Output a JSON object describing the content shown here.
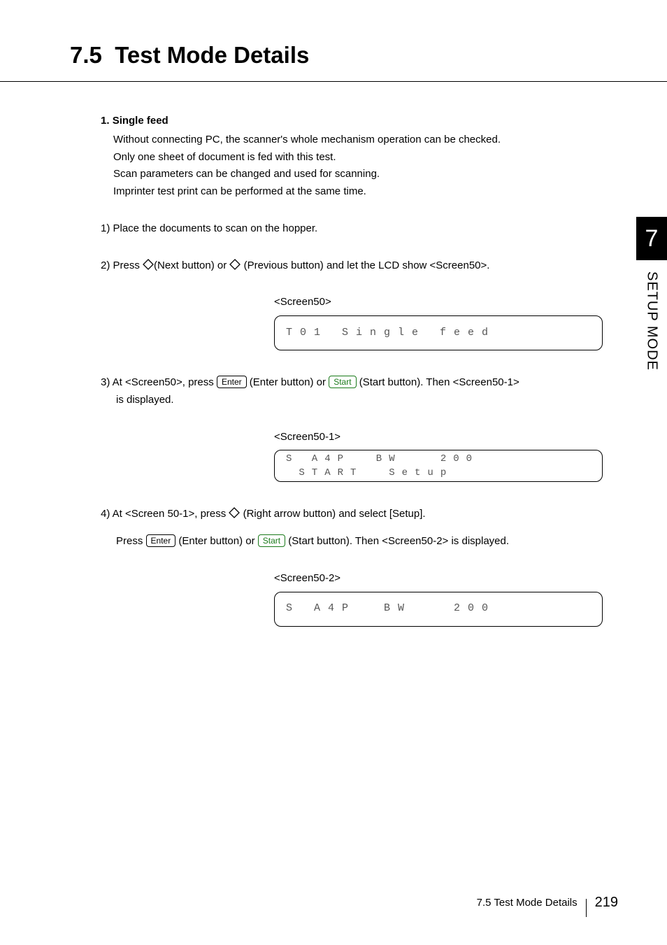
{
  "section": {
    "number": "7.5",
    "title": "Test Mode Details"
  },
  "item": {
    "number": "1.",
    "name": "Single feed",
    "desc_l1": "Without connecting PC, the scanner's whole mechanism operation can be checked.",
    "desc_l2": "Only one sheet of document is fed with this test.",
    "desc_l3": "Scan parameters can be changed and used for scanning.",
    "desc_l4": "Imprinter test print can be performed at the same time."
  },
  "steps": {
    "s1": "1) Place the documents to scan on the hopper.",
    "s2_a": "2) Press ",
    "s2_b": "(Next button) or ",
    "s2_c": " (Previous button) and let the LCD show <Screen50>.",
    "s3_a": "3) At <Screen50>, press ",
    "s3_enter": "Enter",
    "s3_b": " (Enter button) or ",
    "s3_start": "Start",
    "s3_c": " (Start button). Then <Screen50-1>",
    "s3_d": "is displayed.",
    "s4_a": "4) At <Screen 50-1>, press ",
    "s4_b": " (Right arrow button) and select [Setup].",
    "s4_c_a": "Press ",
    "s4_c_b": " (Enter button) or ",
    "s4_c_c": " (Start button). Then <Screen50-2> is displayed."
  },
  "screens": {
    "s50_label": "<Screen50>",
    "s50_row1": "T01 Single feed",
    "s50_1_label": "<Screen50-1>",
    "s50_1_row1": "S A4P  BW   200",
    "s50_1_row2": " START  Setup",
    "s50_2_label": "<Screen50-2>",
    "s50_2_row1": "S A4P  BW   200"
  },
  "sidetab": {
    "num": "7",
    "text": "SETUP MODE"
  },
  "footer": {
    "label": "7.5  Test Mode Details",
    "page": "219"
  }
}
